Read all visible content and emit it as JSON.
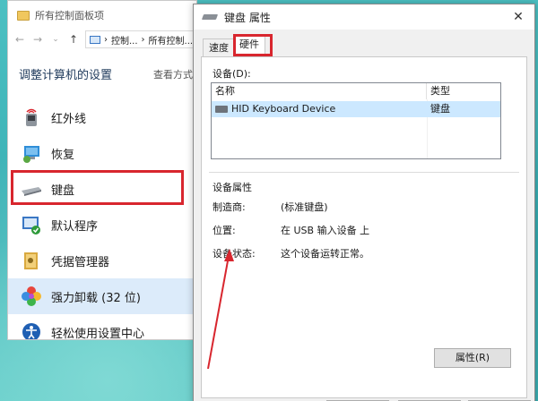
{
  "control_panel": {
    "title": "所有控制面板项",
    "address_parts": [
      "控制...",
      "所有控制..."
    ],
    "heading": "调整计算机的设置",
    "view_by": "查看方式",
    "items": [
      {
        "label": "红外线",
        "icon": "infrared-icon"
      },
      {
        "label": "恢复",
        "icon": "recovery-icon"
      },
      {
        "label": "键盘",
        "icon": "keyboard-icon"
      },
      {
        "label": "默认程序",
        "icon": "default-programs-icon"
      },
      {
        "label": "凭据管理器",
        "icon": "credential-manager-icon"
      },
      {
        "label": "强力卸载 (32 位)",
        "icon": "uninstaller-icon"
      },
      {
        "label": "轻松使用设置中心",
        "icon": "ease-of-access-icon"
      }
    ]
  },
  "dialog": {
    "title": "键盘 属性",
    "tabs": [
      "速度",
      "硬件"
    ],
    "active_tab": "硬件",
    "devices_label": "设备(D):",
    "table": {
      "columns": [
        "名称",
        "类型"
      ],
      "rows": [
        {
          "name": "HID Keyboard Device",
          "type": "键盘"
        }
      ]
    },
    "properties": {
      "title": "设备属性",
      "manufacturer_label": "制造商:",
      "manufacturer_value": "(标准键盘)",
      "location_label": "位置:",
      "location_value": "在 USB 输入设备 上",
      "status_label": "设备状态:",
      "status_value": "这个设备运转正常。"
    },
    "properties_button": "属性(R)"
  },
  "colors": {
    "annotation_red": "#d8262e",
    "selection_blue": "#cce8ff",
    "desktop_teal": "#3fb3b6"
  }
}
